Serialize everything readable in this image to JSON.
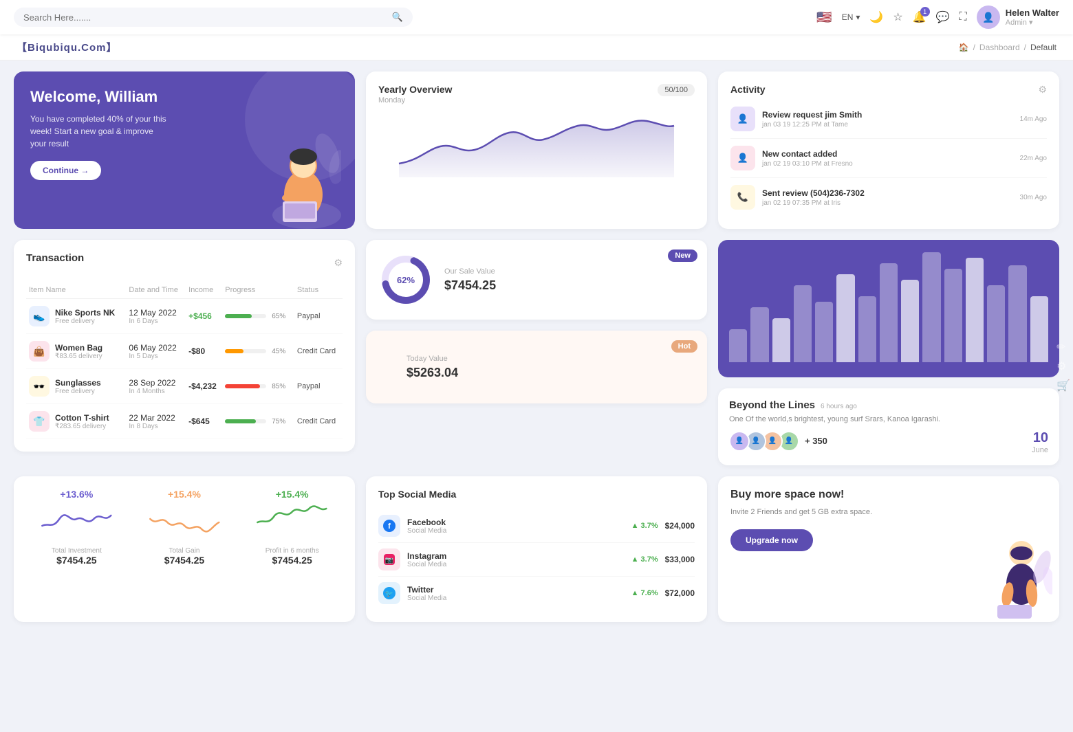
{
  "topnav": {
    "search_placeholder": "Search Here.......",
    "lang": "EN",
    "user": {
      "name": "Helen Walter",
      "role": "Admin"
    },
    "notification_count": "1"
  },
  "breadcrumb": {
    "brand": "【Biqubiqu.Com】",
    "home": "🏠",
    "separator": "/",
    "dashboard": "Dashboard",
    "current": "Default"
  },
  "welcome": {
    "title": "Welcome, William",
    "subtitle": "You have completed 40% of your this week! Start a new goal & improve your result",
    "button": "Continue →"
  },
  "yearly_overview": {
    "title": "Yearly Overview",
    "subtitle": "Monday",
    "badge": "50/100"
  },
  "activity": {
    "title": "Activity",
    "items": [
      {
        "title": "Review request jim Smith",
        "sub": "jan 03 19 12:25 PM at Tame",
        "time": "14m Ago"
      },
      {
        "title": "New contact added",
        "sub": "jan 02 19 03:10 PM at Fresno",
        "time": "22m Ago"
      },
      {
        "title": "Sent review (504)236-7302",
        "sub": "jan 02 19 07:35 PM at Iris",
        "time": "30m Ago"
      }
    ]
  },
  "transaction": {
    "title": "Transaction",
    "headers": [
      "Item Name",
      "Date and Time",
      "Income",
      "Progress",
      "Status"
    ],
    "rows": [
      {
        "name": "Nike Sports NK",
        "desc": "Free delivery",
        "date": "12 May 2022",
        "days": "In 6 Days",
        "income": "+$456",
        "income_pos": true,
        "progress": 65,
        "progress_color": "#4caf50",
        "status": "Paypal",
        "icon": "👟",
        "icon_bg": "#e8f0fe"
      },
      {
        "name": "Women Bag",
        "desc": "₹83.65 delivery",
        "date": "06 May 2022",
        "days": "In 5 Days",
        "income": "-$80",
        "income_pos": false,
        "progress": 45,
        "progress_color": "#ff9800",
        "status": "Credit Card",
        "icon": "👜",
        "icon_bg": "#fce4ec"
      },
      {
        "name": "Sunglasses",
        "desc": "Free delivery",
        "date": "28 Sep 2022",
        "days": "In 4 Months",
        "income": "-$4,232",
        "income_pos": false,
        "progress": 85,
        "progress_color": "#f44336",
        "status": "Paypal",
        "icon": "🕶️",
        "icon_bg": "#fff8e1"
      },
      {
        "name": "Cotton T-shirt",
        "desc": "₹283.65 delivery",
        "date": "22 Mar 2022",
        "days": "In 8 Days",
        "income": "-$645",
        "income_pos": false,
        "progress": 75,
        "progress_color": "#4caf50",
        "status": "Credit Card",
        "icon": "👕",
        "icon_bg": "#fce4ec"
      }
    ]
  },
  "sale_value": {
    "new_badge": "New",
    "donut_pct": "62%",
    "label": "Our Sale Value",
    "value": "$7454.25"
  },
  "today_value": {
    "hot_badge": "Hot",
    "label": "Today Value",
    "value": "$5263.04"
  },
  "bar_chart": {
    "bars": [
      30,
      50,
      40,
      70,
      55,
      80,
      60,
      90,
      75,
      100,
      85,
      95,
      70,
      88,
      60
    ]
  },
  "beyond": {
    "title": "Beyond the Lines",
    "time_ago": "6 hours ago",
    "desc": "One Of the world,s brightest, young surf Srars, Kanoa Igarashi.",
    "plus_count": "+ 350",
    "date": "10",
    "month": "June"
  },
  "investments": [
    {
      "pct": "+13.6%",
      "pct_color": "#6c5ecf",
      "label": "Total Investment",
      "value": "$7454.25"
    },
    {
      "pct": "+15.4%",
      "pct_color": "#f4a261",
      "label": "Total Gain",
      "value": "$7454.25"
    },
    {
      "pct": "+15.4%",
      "pct_color": "#4caf50",
      "label": "Profit in 6 months",
      "value": "$7454.25"
    }
  ],
  "social_media": {
    "title": "Top Social Media",
    "items": [
      {
        "name": "Facebook",
        "type": "Social Media",
        "pct": "3.7%",
        "value": "$24,000",
        "icon": "f",
        "icon_bg": "#e8f0fe",
        "icon_color": "#1877f2"
      },
      {
        "name": "Instagram",
        "type": "Social Media",
        "pct": "3.7%",
        "value": "$33,000",
        "icon": "📷",
        "icon_bg": "#fce4ec",
        "icon_color": "#e91e63"
      },
      {
        "name": "Twitter",
        "type": "Social Media",
        "pct": "7.6%",
        "value": "$72,000",
        "icon": "🐦",
        "icon_bg": "#e3f2fd",
        "icon_color": "#1da1f2"
      }
    ]
  },
  "buy_space": {
    "title": "Buy more space now!",
    "desc": "Invite 2 Friends and get 5 GB extra space.",
    "button": "Upgrade now"
  }
}
